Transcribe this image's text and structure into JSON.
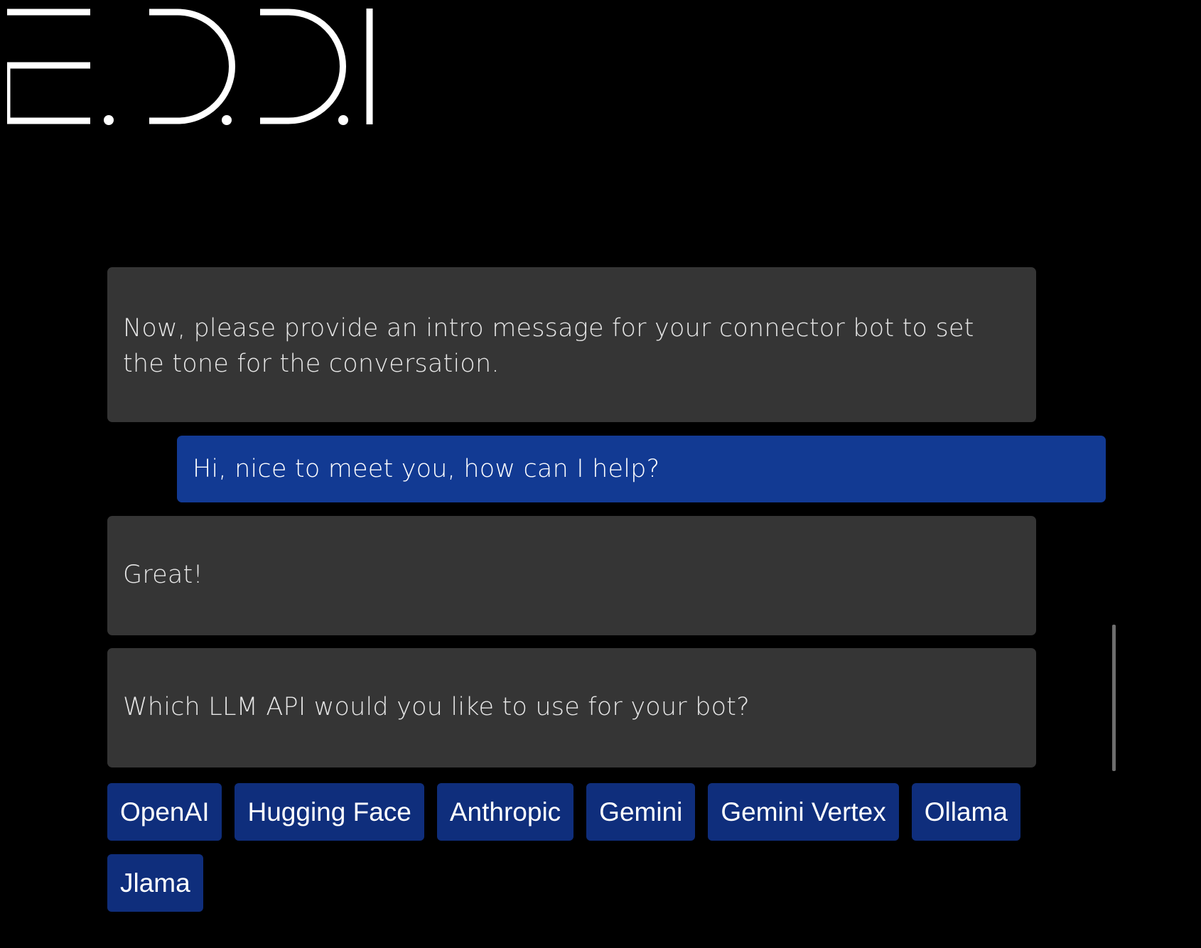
{
  "logo": {
    "text": "E.D.D.I"
  },
  "messages": [
    {
      "role": "bot",
      "text": "Now, please provide an intro message for your connector bot to set the tone for the conversation."
    },
    {
      "role": "user",
      "text": "Hi, nice to meet you, how can I help?"
    },
    {
      "role": "bot",
      "text": "Great!"
    },
    {
      "role": "bot",
      "text": "Which LLM API would you like to use for your bot?"
    }
  ],
  "quick_replies": [
    "OpenAI",
    "Hugging Face",
    "Anthropic",
    "Gemini",
    "Gemini Vertex",
    "Ollama",
    "Jlama"
  ],
  "colors": {
    "background": "#000000",
    "bot_bubble": "#353535",
    "user_bubble": "#123a93",
    "quick_reply": "#0f2e7c",
    "text": "#ffffff"
  }
}
